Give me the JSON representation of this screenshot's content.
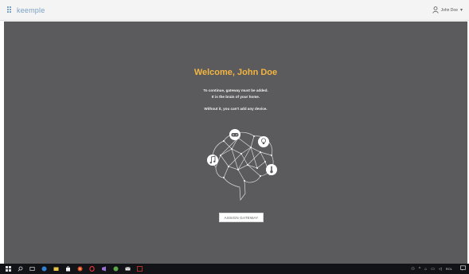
{
  "app": {
    "name": "keemple"
  },
  "header": {
    "user_name": "John Doe",
    "user_caret": "▾"
  },
  "main": {
    "welcome_title": "Welcome, John Doe",
    "message_line1": "To continue, gateway must be added.",
    "message_line2": "It is the brain of your home.",
    "message_line3": "Without it, you can't add any device.",
    "assign_button_label": "ASSIGN GATEWAY",
    "illustration_icons": [
      "gamepad-icon",
      "lightbulb-icon",
      "music-note-icon",
      "thermometer-icon"
    ]
  },
  "colors": {
    "header_bg": "#f4f4f4",
    "main_bg": "#5b5b5d",
    "title_color": "#f2b540",
    "brand_color": "#7aa0c4",
    "taskbar_bg": "#111316"
  },
  "taskbar": {
    "icons": [
      "windows-start-icon",
      "search-icon",
      "task-view-icon",
      "edge-browser-icon",
      "file-explorer-icon",
      "store-icon",
      "chrome-icon",
      "opera-icon",
      "visual-studio-icon",
      "app-icon",
      "mail-icon",
      "acrobat-icon"
    ],
    "tray": {
      "language": "ROL"
    }
  }
}
